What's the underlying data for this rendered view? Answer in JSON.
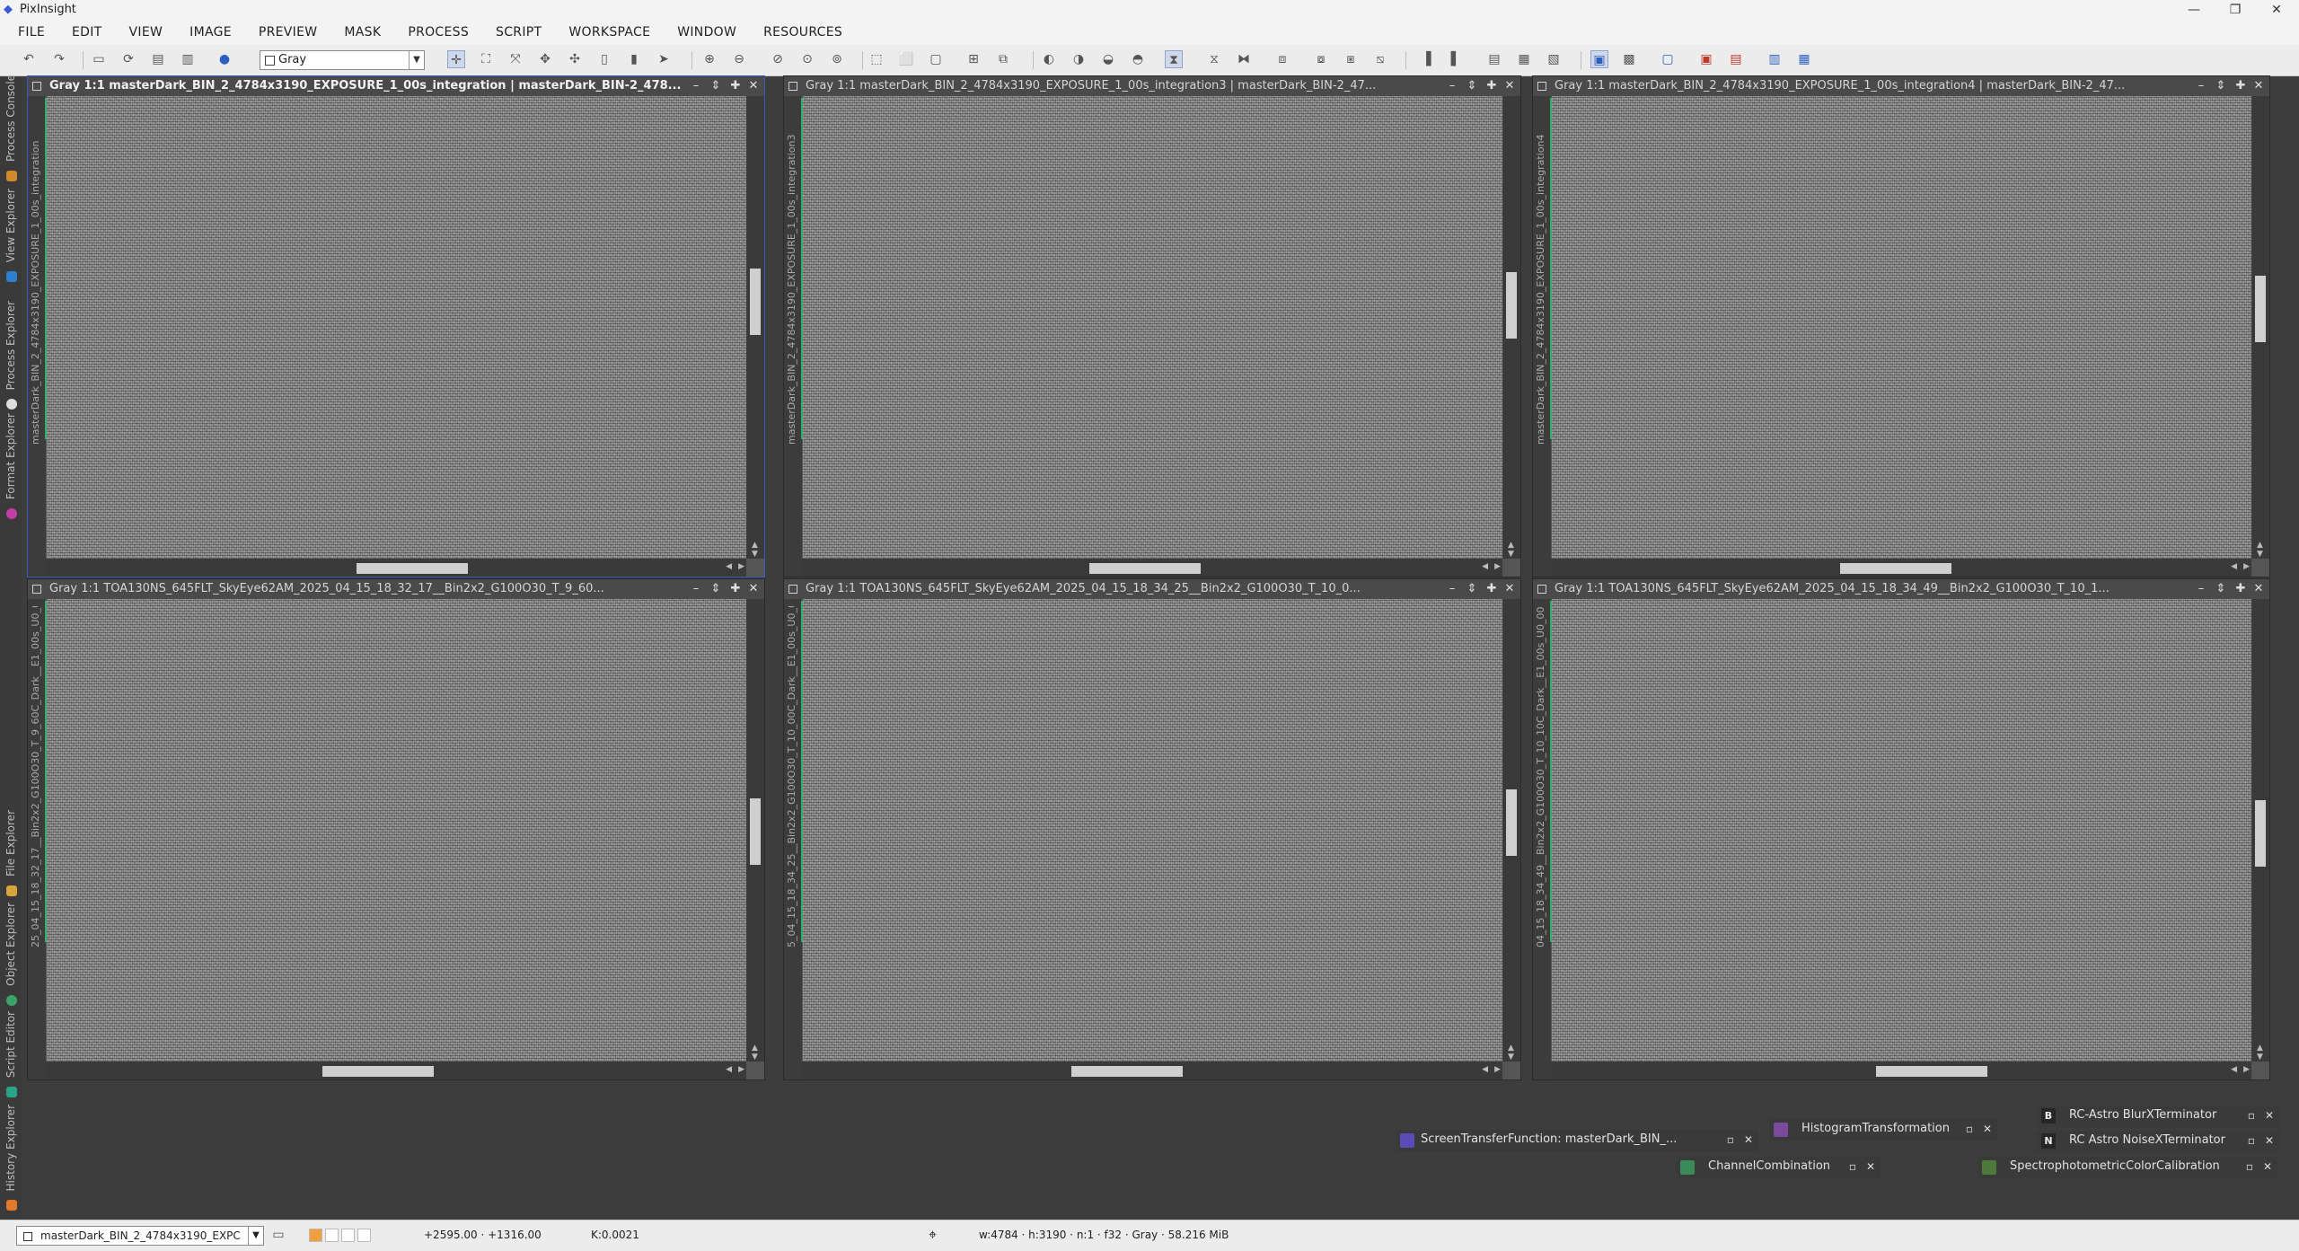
{
  "app": {
    "title": "PixInsight"
  },
  "window_controls": {
    "minimize": "—",
    "restore": "❐",
    "close": "✕"
  },
  "menu": [
    "FILE",
    "EDIT",
    "VIEW",
    "IMAGE",
    "PREVIEW",
    "MASK",
    "PROCESS",
    "SCRIPT",
    "WORKSPACE",
    "WINDOW",
    "RESOURCES"
  ],
  "toolbar": {
    "view_selector_value": "Gray"
  },
  "left_dock_tabs": [
    "Process Console",
    "View Explorer",
    "Process Explorer",
    "Format Explorer",
    "File Explorer",
    "Object Explorer",
    "Script Editor",
    "History Explorer"
  ],
  "image_windows": [
    {
      "title": "Gray 1:1 masterDark_BIN_2_4784x3190_EXPOSURE_1_00s_integration | masterDark_BIN-2_478...",
      "id": "masterDark_BIN_2_4784x3190_EXPOSURE_1_00s_integration",
      "active": true
    },
    {
      "title": "Gray 1:1 masterDark_BIN_2_4784x3190_EXPOSURE_1_00s_integration3 | masterDark_BIN-2_47...",
      "id": "masterDark_BIN_2_4784x3190_EXPOSURE_1_00s_integration3",
      "active": false
    },
    {
      "title": "Gray 1:1 masterDark_BIN_2_4784x3190_EXPOSURE_1_00s_integration4 | masterDark_BIN-2_47...",
      "id": "masterDark_BIN_2_4784x3190_EXPOSURE_1_00s_integration4",
      "active": false
    },
    {
      "title": "Gray 1:1 TOA130NS_645FLT_SkyEye62AM_2025_04_15_18_32_17__Bin2x2_G100O30_T_9_60...",
      "id": "25_04_15_18_32_17__Bin2x2_G100O30_T_9_60C_Dark__E1_00s_U0_0000",
      "active": false
    },
    {
      "title": "Gray 1:1 TOA130NS_645FLT_SkyEye62AM_2025_04_15_18_34_25__Bin2x2_G100O30_T_10_0...",
      "id": "5_04_15_18_34_25__Bin2x2_G100O30_T_10_00C_Dark__E1_00s_U0_0000",
      "active": false
    },
    {
      "title": "Gray 1:1 TOA130NS_645FLT_SkyEye62AM_2025_04_15_18_34_49__Bin2x2_G100O30_T_10_1...",
      "id": "04_15_18_34_49__Bin2x2_G100O30_T_10_10C_Dark__E1_00s_U0_0000",
      "active": false
    }
  ],
  "process_icons": [
    {
      "label": "ScreenTransferFunction: masterDark_BIN_...",
      "icon": "stf-icon",
      "color": "#5a4bb8"
    },
    {
      "label": "HistogramTransformation",
      "icon": "histogram-icon",
      "color": "#7a4a9c"
    },
    {
      "label": "ChannelCombination",
      "icon": "channel-combination-icon",
      "color": "#3b8a5a"
    },
    {
      "label": "RC-Astro BlurXTerminator",
      "icon": "letter-b-icon",
      "letter": "B"
    },
    {
      "label": "RC Astro NoiseXTerminator",
      "icon": "letter-n-icon",
      "letter": "N"
    },
    {
      "label": "SpectrophotometricColorCalibration",
      "icon": "spcc-icon",
      "color": "#4d7a3a"
    }
  ],
  "status": {
    "view": "masterDark_BIN_2_4784x3190_EXPC",
    "coords": "+2595.00 · +1316.00",
    "value": "K:0.0021",
    "info": "w:4784 · h:3190 · n:1 · f32 · Gray · 58.216 MiB"
  }
}
